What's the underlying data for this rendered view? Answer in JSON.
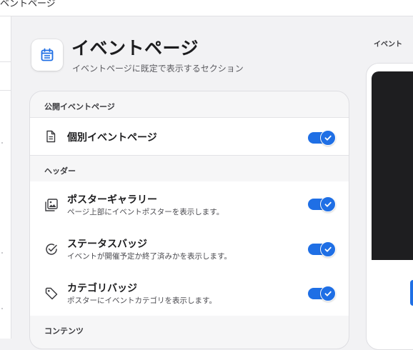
{
  "window": {
    "title": "イベントページ"
  },
  "header": {
    "title": "イベントページ",
    "subtitle": "イベントページに既定で表示するセクション",
    "icon": "calendar-icon"
  },
  "preview": {
    "label": "イベント"
  },
  "sections": [
    {
      "label": "公開イベントページ",
      "items": [
        {
          "title": "個別イベントページ",
          "description": "",
          "icon": "document-icon",
          "enabled": true
        }
      ]
    },
    {
      "label": "ヘッダー",
      "items": [
        {
          "title": "ポスターギャラリー",
          "description": "ページ上部にイベントポスターを表示します。",
          "icon": "photo-gallery-icon",
          "enabled": true
        },
        {
          "title": "ステータスバッジ",
          "description": "イベントが開催予定か終了済みかを表示します。",
          "icon": "checkmark-circle-icon",
          "enabled": true
        },
        {
          "title": "カテゴリバッジ",
          "description": "ポスターにイベントカテゴリを表示します。",
          "icon": "tag-icon",
          "enabled": true
        }
      ]
    },
    {
      "label": "コンテンツ",
      "items": []
    }
  ],
  "colors": {
    "accent": "#1f6fe5",
    "background": "#f2f2f4",
    "card": "#ffffff"
  }
}
